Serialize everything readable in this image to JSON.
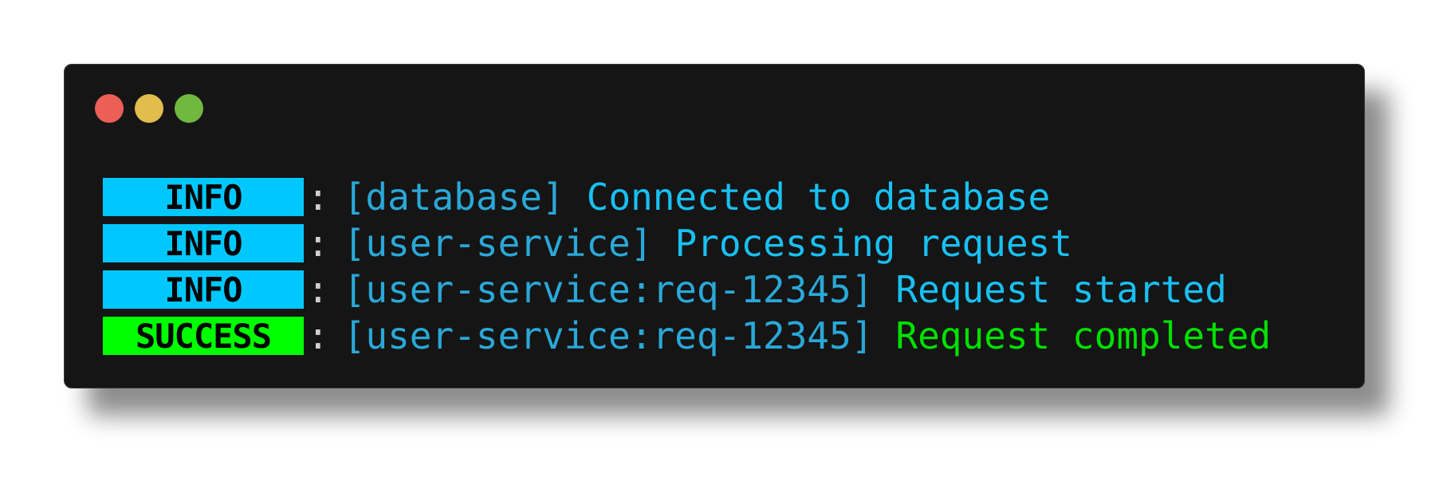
{
  "colors": {
    "window_bg": "#151515",
    "dot_red": "#ec5f57",
    "dot_yellow": "#e0bd4c",
    "dot_green": "#70b840",
    "info_badge": "#00c8ff",
    "success_badge": "#00ff00",
    "scope_text": "#2aa8d8",
    "info_message": "#19c0f2",
    "success_message": "#00e000"
  },
  "window": {
    "controls": [
      "close-dot",
      "minimize-dot",
      "zoom-dot"
    ]
  },
  "log": {
    "separator": ":",
    "lines": [
      {
        "level": "INFO",
        "scope": "[database]",
        "message": "Connected to database"
      },
      {
        "level": "INFO",
        "scope": "[user-service]",
        "message": "Processing request"
      },
      {
        "level": "INFO",
        "scope": "[user-service:req-12345]",
        "message": "Request started"
      },
      {
        "level": "SUCCESS",
        "scope": "[user-service:req-12345]",
        "message": "Request completed"
      }
    ]
  }
}
